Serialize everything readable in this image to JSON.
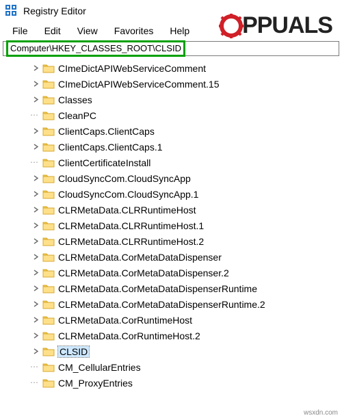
{
  "window": {
    "title": "Registry Editor"
  },
  "menu": {
    "file": "File",
    "edit": "Edit",
    "view": "View",
    "favorites": "Favorites",
    "help": "Help"
  },
  "address": {
    "path": "Computer\\HKEY_CLASSES_ROOT\\CLSID"
  },
  "watermark": {
    "text": "PPUALS"
  },
  "footer": {
    "credit": "wsxdn.com"
  },
  "tree": {
    "items": [
      {
        "label": "CImeDictAPIWebServiceComment",
        "expander": true,
        "selected": false
      },
      {
        "label": "CImeDictAPIWebServiceComment.15",
        "expander": true,
        "selected": false
      },
      {
        "label": "Classes",
        "expander": true,
        "selected": false
      },
      {
        "label": "CleanPC",
        "expander": false,
        "selected": false
      },
      {
        "label": "ClientCaps.ClientCaps",
        "expander": true,
        "selected": false
      },
      {
        "label": "ClientCaps.ClientCaps.1",
        "expander": true,
        "selected": false
      },
      {
        "label": "ClientCertificateInstall",
        "expander": false,
        "selected": false
      },
      {
        "label": "CloudSyncCom.CloudSyncApp",
        "expander": true,
        "selected": false
      },
      {
        "label": "CloudSyncCom.CloudSyncApp.1",
        "expander": true,
        "selected": false
      },
      {
        "label": "CLRMetaData.CLRRuntimeHost",
        "expander": true,
        "selected": false
      },
      {
        "label": "CLRMetaData.CLRRuntimeHost.1",
        "expander": true,
        "selected": false
      },
      {
        "label": "CLRMetaData.CLRRuntimeHost.2",
        "expander": true,
        "selected": false
      },
      {
        "label": "CLRMetaData.CorMetaDataDispenser",
        "expander": true,
        "selected": false
      },
      {
        "label": "CLRMetaData.CorMetaDataDispenser.2",
        "expander": true,
        "selected": false
      },
      {
        "label": "CLRMetaData.CorMetaDataDispenserRuntime",
        "expander": true,
        "selected": false
      },
      {
        "label": "CLRMetaData.CorMetaDataDispenserRuntime.2",
        "expander": true,
        "selected": false
      },
      {
        "label": "CLRMetaData.CorRuntimeHost",
        "expander": true,
        "selected": false
      },
      {
        "label": "CLRMetaData.CorRuntimeHost.2",
        "expander": true,
        "selected": false
      },
      {
        "label": "CLSID",
        "expander": true,
        "selected": true
      },
      {
        "label": "CM_CellularEntries",
        "expander": false,
        "selected": false
      },
      {
        "label": "CM_ProxyEntries",
        "expander": false,
        "selected": false
      }
    ]
  }
}
